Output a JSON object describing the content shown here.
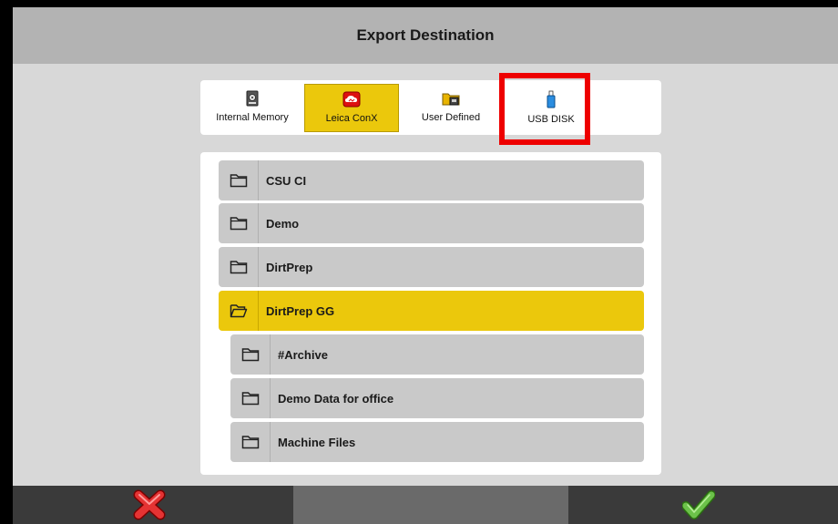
{
  "header": {
    "title": "Export Destination"
  },
  "destinations": [
    {
      "label": "Internal Memory",
      "icon": "hard-drive-icon",
      "selected": false
    },
    {
      "label": "Leica ConX",
      "icon": "cloud-icon",
      "selected": true
    },
    {
      "label": "User Defined",
      "icon": "network-folder-icon",
      "selected": false
    },
    {
      "label": "USB DISK",
      "icon": "usb-drive-icon",
      "selected": false
    }
  ],
  "folders": [
    {
      "name": "CSU CI",
      "open": false,
      "level": 0
    },
    {
      "name": "Demo",
      "open": false,
      "level": 0
    },
    {
      "name": "DirtPrep",
      "open": false,
      "level": 0
    },
    {
      "name": "DirtPrep GG",
      "open": true,
      "level": 0
    },
    {
      "name": "#Archive",
      "open": false,
      "level": 1
    },
    {
      "name": "Demo Data for office",
      "open": false,
      "level": 1
    },
    {
      "name": "Machine Files",
      "open": false,
      "level": 1
    }
  ],
  "footer": {
    "cancel_icon": "cancel-x-icon",
    "confirm_icon": "confirm-check-icon"
  },
  "colors": {
    "accent": "#ebc80c",
    "highlight": "#ee0000",
    "cancel": "#e53333",
    "confirm": "#6cc24a"
  }
}
